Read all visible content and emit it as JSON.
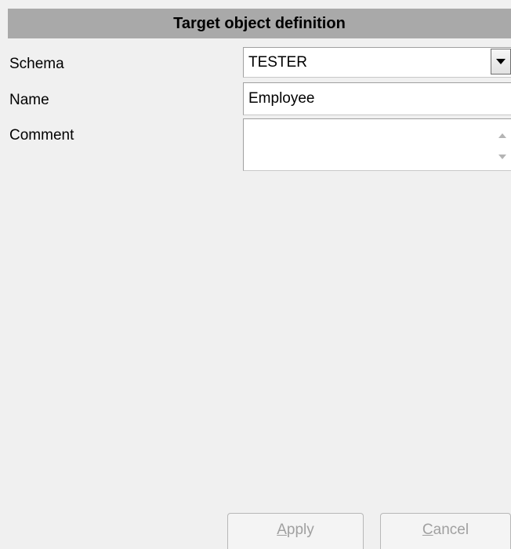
{
  "header": {
    "title": "Target object definition"
  },
  "schema": {
    "label": "Schema",
    "value": "TESTER"
  },
  "name": {
    "label": "Name",
    "value": "Employee"
  },
  "comment": {
    "label": "Comment",
    "value": ""
  },
  "buttons": {
    "apply": {
      "mnemonic": "A",
      "rest": "pply",
      "enabled": false
    },
    "cancel": {
      "mnemonic": "C",
      "rest": "ancel",
      "enabled": false
    }
  }
}
